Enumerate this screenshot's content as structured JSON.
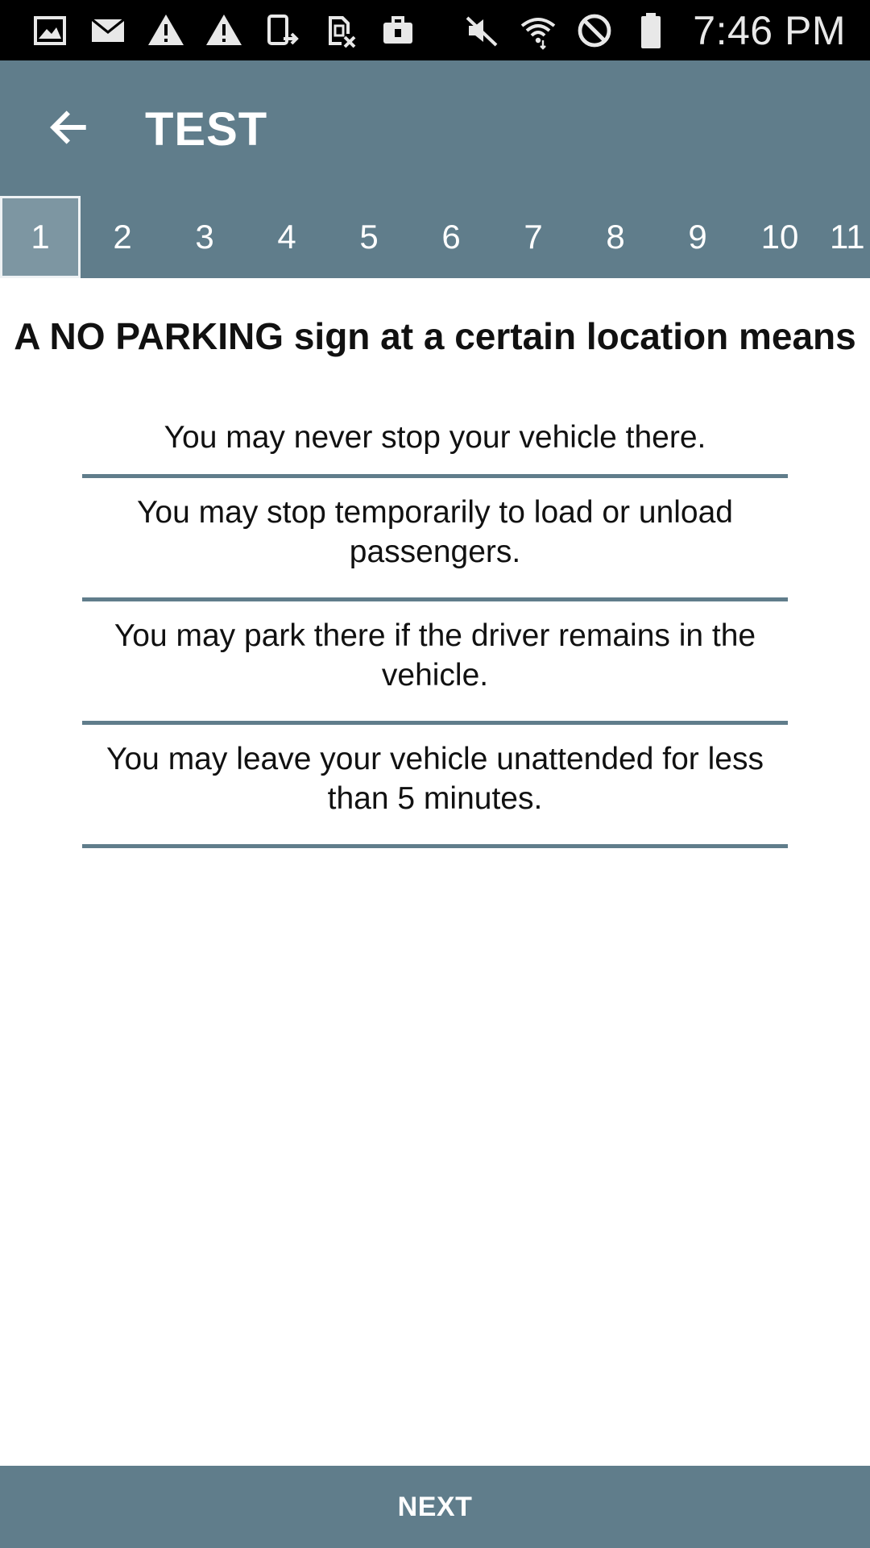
{
  "status_bar": {
    "time": "7:46 PM",
    "left_icons": [
      "gallery-icon",
      "email-icon",
      "warning-icon",
      "warning-icon",
      "phone-transfer-icon",
      "sim-blocked-icon",
      "briefcase-icon"
    ],
    "right_icons": [
      "mute-icon",
      "wifi-icon",
      "do-not-disturb-icon",
      "battery-icon"
    ]
  },
  "app_bar": {
    "back_icon": "arrow-back-icon",
    "title": "TEST"
  },
  "tabs": {
    "active": "1",
    "items": [
      "1",
      "2",
      "3",
      "4",
      "5",
      "6",
      "7",
      "8",
      "9",
      "10",
      "11"
    ]
  },
  "question": {
    "text": "A NO PARKING sign at a certain location means"
  },
  "answers": [
    "You may never stop your vehicle there.",
    "You may stop temporarily to load or unload passengers.",
    "You may park there if the driver remains in the vehicle.",
    "You may leave your vehicle unattended for less than 5 minutes."
  ],
  "footer": {
    "next_label": "NEXT"
  },
  "colors": {
    "primary": "#607d8b",
    "active_tab": "#7d96a2",
    "text": "#111111",
    "status_bar": "#000000"
  }
}
